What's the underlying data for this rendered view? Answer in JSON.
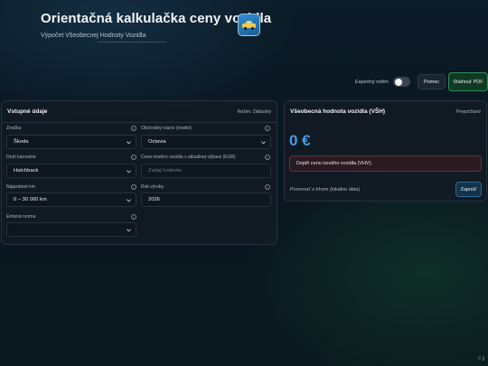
{
  "header": {
    "title": "Orientačná kalkulačka ceny vozidla",
    "subtitle": "Výpočet Všeobecnej Hodnoty Vozidla",
    "logo_icon": "car-logo-icon"
  },
  "toolbar": {
    "expert_mode_label": "Expertný režim",
    "expert_mode_on": false,
    "help_label": "Pomoc",
    "pdf_label": "Stiahnuť PDF"
  },
  "inputs_card": {
    "title": "Vstupné údaje",
    "mode_label": "Režim: Základný",
    "fields": {
      "brand": {
        "label": "Značka",
        "value": "Škoda"
      },
      "model": {
        "label": "Obchodný názov (model)",
        "value": "Octavia"
      },
      "body": {
        "label": "Druh karosérie",
        "value": "Hatchback"
      },
      "price": {
        "label": "Cena nového vozidla v aktuálnej výbave (EUR)",
        "placeholder": "Zadaj hodnotu"
      },
      "mileage": {
        "label": "Najazdené km",
        "value": "0 – 30 000 km"
      },
      "year": {
        "label": "Rok výroby",
        "value": "2026"
      },
      "emission": {
        "label": "Emisná norma",
        "value": ""
      }
    }
  },
  "result_card": {
    "title": "Všeobecná hodnota vozidla (VŠH)",
    "recalc_label": "Prepočítané",
    "value": "0 €",
    "alert": "Doplň cenu nového vozidla (VHV).",
    "compare_text": "Porovnať s trhom (lokálne dáta)",
    "compare_button": "Zapnúť"
  },
  "footer": {
    "mark": "© jj"
  },
  "colors": {
    "accent_blue": "#3f9ee8",
    "pdf_green": "#2f8f57",
    "alert_bg": "#2a1b22"
  }
}
